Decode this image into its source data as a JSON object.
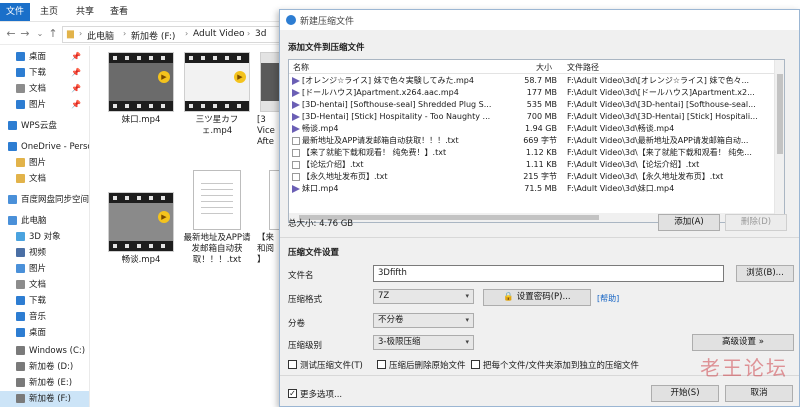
{
  "ribbon": {
    "tabs": [
      "文件",
      "主页",
      "共享",
      "查看"
    ]
  },
  "address": {
    "crumbs": [
      "此电脑",
      "新加卷 (F:)",
      "Adult Video",
      "3d"
    ]
  },
  "sidebar": {
    "items": [
      {
        "label": "桌面",
        "pinned": true,
        "color": "#2d7dd2"
      },
      {
        "label": "下载",
        "pinned": true,
        "color": "#2d7dd2"
      },
      {
        "label": "文档",
        "pinned": true,
        "color": "#8c8c8c"
      },
      {
        "label": "图片",
        "pinned": true,
        "color": "#2d7dd2"
      },
      {
        "label": "WPS云盘",
        "pinned": false,
        "color": "#2d7dd2"
      },
      {
        "label": "OneDrive - Perso",
        "pinned": false,
        "color": "#2d7dd2"
      },
      {
        "label": "图片",
        "pinned": false,
        "color": "#e2b34a"
      },
      {
        "label": "文档",
        "pinned": false,
        "color": "#e2b34a"
      },
      {
        "label": "百度网盘同步空间",
        "pinned": false,
        "color": "#4a90d9"
      },
      {
        "label": "此电脑",
        "pinned": false,
        "color": "#4a90d9"
      },
      {
        "label": "3D 对象",
        "pinned": false,
        "color": "#4aa3df"
      },
      {
        "label": "视频",
        "pinned": false,
        "color": "#4a6fa5"
      },
      {
        "label": "图片",
        "pinned": false,
        "color": "#4a90d9"
      },
      {
        "label": "文档",
        "pinned": false,
        "color": "#8c8c8c"
      },
      {
        "label": "下载",
        "pinned": false,
        "color": "#2d7dd2"
      },
      {
        "label": "音乐",
        "pinned": false,
        "color": "#2d7dd2"
      },
      {
        "label": "桌面",
        "pinned": false,
        "color": "#2d7dd2"
      },
      {
        "label": "Windows (C:)",
        "pinned": false,
        "color": "#7a7a7a"
      },
      {
        "label": "新加卷 (D:)",
        "pinned": false,
        "color": "#7a7a7a"
      },
      {
        "label": "新加卷 (E:)",
        "pinned": false,
        "color": "#7a7a7a"
      },
      {
        "label": "新加卷 (F:)",
        "pinned": false,
        "color": "#7a7a7a"
      }
    ]
  },
  "files": [
    {
      "label": "妹口.mp4",
      "kind": "video"
    },
    {
      "label": "三ツ星カフェ.mp4",
      "kind": "video"
    },
    {
      "label": "[3 Vice Afte",
      "kind": "video"
    },
    {
      "label": "畅谈.mp4",
      "kind": "video"
    },
    {
      "label": "最新地址及APP请发邮箱自动获取！！！.txt",
      "kind": "txt"
    },
    {
      "label": "【来 和阅 】",
      "kind": "txt"
    }
  ],
  "dialog": {
    "title": "新建压缩文件",
    "add_section": "添加文件到压缩文件",
    "columns": {
      "name": "名称",
      "size": "大小",
      "path": "文件路径"
    },
    "rows": [
      {
        "name": "[オレンジ☆ライス] 妹で色々実験してみた.mp4",
        "size": "58.7 MB",
        "path": "F:\\Adult Video\\3d\\[オレンジ☆ライス] 妹で色々...",
        "kind": "video"
      },
      {
        "name": "[ドールハウス]Apartment.x264.aac.mp4",
        "size": "177 MB",
        "path": "F:\\Adult Video\\3d\\[ドールハウス]Apartment.x2...",
        "kind": "video"
      },
      {
        "name": "[3D-hentai] [Softhouse-seal] Shredded Plug S...",
        "size": "535 MB",
        "path": "F:\\Adult Video\\3d\\[3D-hentai] [Softhouse-seal...",
        "kind": "video"
      },
      {
        "name": "[3D-Hentai] [Stick] Hospitality - Too Naughty ...",
        "size": "700 MB",
        "path": "F:\\Adult Video\\3d\\[3D-Hentai] [Stick] Hospitali...",
        "kind": "video"
      },
      {
        "name": "畅谈.mp4",
        "size": "1.94 GB",
        "path": "F:\\Adult Video\\3d\\畅谈.mp4",
        "kind": "video"
      },
      {
        "name": "最新地址及APP请发邮箱自动获取！！！.txt",
        "size": "669 字节",
        "path": "F:\\Adult Video\\3d\\最新地址及APP请发邮箱自动...",
        "kind": "txt"
      },
      {
        "name": "【来了就能下载和观看！ 纯免费！】.txt",
        "size": "1.12 KB",
        "path": "F:\\Adult Video\\3d\\【来了就能下载和观看！ 纯免...",
        "kind": "txt"
      },
      {
        "name": "【论坛介绍】.txt",
        "size": "1.11 KB",
        "path": "F:\\Adult Video\\3d\\【论坛介绍】.txt",
        "kind": "txt"
      },
      {
        "name": "【永久地址发布页】.txt",
        "size": "215 字节",
        "path": "F:\\Adult Video\\3d\\【永久地址发布页】.txt",
        "kind": "txt"
      },
      {
        "name": "妹口.mp4",
        "size": "71.5 MB",
        "path": "F:\\Adult Video\\3d\\妹口.mp4",
        "kind": "video"
      }
    ],
    "total": "总大小: 4.76 GB",
    "add_button": "添加(A)",
    "delete_button": "删除(D)",
    "settings_section": "压缩文件设置",
    "filename_label": "文件名",
    "filename_value": "3Dfifth",
    "browse_button": "浏览(B)...",
    "format_label": "压缩格式",
    "format_value": "7Z",
    "password_button": "设置密码(P)...",
    "help_link": "[帮助]",
    "split_label": "分卷",
    "split_value": "不分卷",
    "level_label": "压缩级别",
    "level_value": "3-极限压缩",
    "advanced_button": "高级设置 »",
    "options": [
      {
        "label": "测试压缩文件(T)",
        "checked": false
      },
      {
        "label": "压缩后删除原始文件",
        "checked": false
      },
      {
        "label": "把每个文件/文件夹添加到独立的压缩文件",
        "checked": false
      }
    ],
    "more_options": "更多选项...",
    "more_checked": true,
    "start_button": "开始(S)",
    "cancel_button": "取消"
  },
  "watermark": "老王论坛",
  "colors": {
    "accent": "#1a6fc9",
    "selected": "#cce4f7",
    "dialog_bg": "#f0f0f0"
  }
}
